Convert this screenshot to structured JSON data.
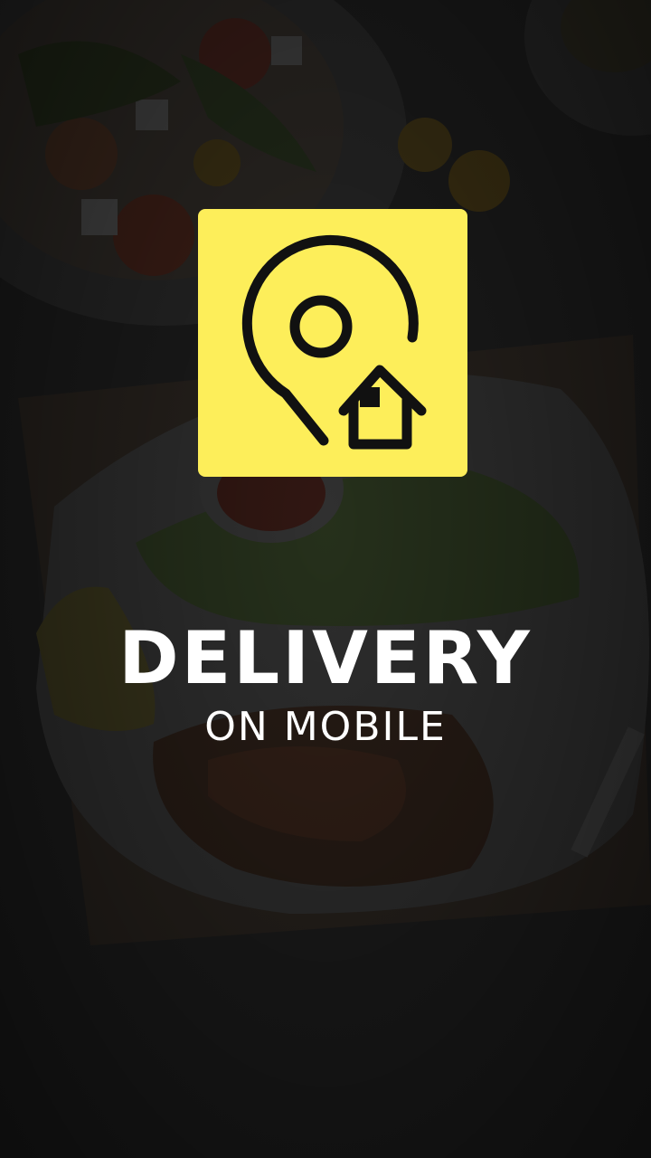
{
  "splash": {
    "logo_icon": "location-pin-home-icon",
    "title": "DELIVERY",
    "subtitle": "ON MOBILE"
  },
  "colors": {
    "logo_background": "#fdee5a",
    "logo_stroke": "#111111",
    "text": "#ffffff",
    "overlay": "#1c1c1c"
  }
}
